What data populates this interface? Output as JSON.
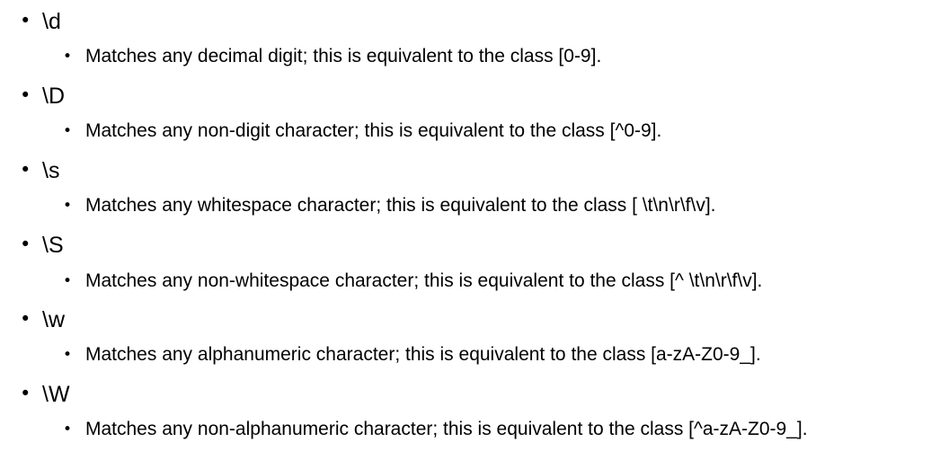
{
  "items": [
    {
      "token": "\\d",
      "description": "Matches any decimal digit; this is equivalent to the class [0-9]."
    },
    {
      "token": "\\D",
      "description": "Matches any non-digit character; this is equivalent to the class [^0-9]."
    },
    {
      "token": "\\s",
      "description": "Matches any whitespace character; this is equivalent to the class [ \\t\\n\\r\\f\\v]."
    },
    {
      "token": "\\S",
      "description": "Matches any non-whitespace character; this is equivalent to the class [^ \\t\\n\\r\\f\\v]."
    },
    {
      "token": "\\w",
      "description": "Matches any alphanumeric character; this is equivalent to the class [a-zA-Z0-9_]."
    },
    {
      "token": "\\W",
      "description": "Matches any non-alphanumeric character; this is equivalent to the class [^a-zA-Z0-9_]."
    }
  ],
  "bullet_glyph": "•"
}
